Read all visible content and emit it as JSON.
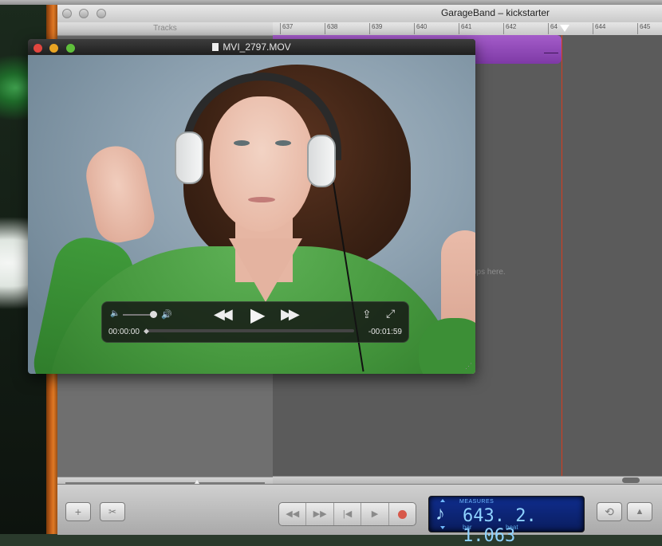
{
  "garageband": {
    "window_title": "GarageBand – kickstarter",
    "tracks_header": "Tracks",
    "ruler_ticks": [
      "637",
      "638",
      "639",
      "640",
      "641",
      "642",
      "64",
      "644",
      "645"
    ],
    "drop_hint": "ops here.",
    "toolbar": {
      "add_track": "+",
      "scissors": "✂",
      "rewind": "◀◀",
      "fast_forward": "▶▶",
      "to_start": "|◀",
      "play": "▶",
      "cycle": "⟲",
      "metronome": "▲"
    },
    "lcd": {
      "mode": "MEASURES",
      "note_icon": "♪",
      "value": "643. 2. 1.063",
      "bar_label": "bar",
      "beat_label": "beat",
      "color": "#8ed2ff"
    }
  },
  "quicktime": {
    "window_title": "MVI_2797.MOV",
    "traffic_lights": [
      "#e2463f",
      "#e9a423",
      "#5fbf3b"
    ],
    "controls": {
      "volume_low_icon": "🔈",
      "volume_high_icon": "🔊",
      "rewind": "◀◀",
      "play": "▶",
      "fast_forward": "▶▶",
      "share_icon": "⇪",
      "fullscreen_icon": "⤢",
      "scrubber_icon": "◆"
    },
    "time_elapsed": "00:00:00",
    "time_remaining": "-00:01:59",
    "resize_icon": "⋰"
  }
}
